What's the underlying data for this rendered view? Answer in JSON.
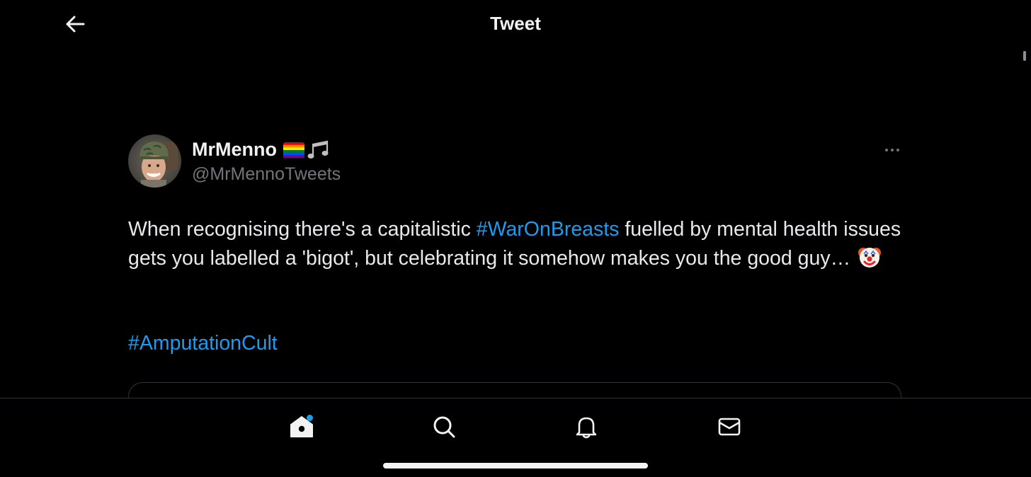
{
  "header": {
    "title": "Tweet",
    "back_icon": "arrow-left-icon"
  },
  "tweet": {
    "author": {
      "display_name": "MrMenno",
      "name_emojis": [
        "rainbow-flag-icon",
        "musical-notes-icon"
      ],
      "handle": "@MrMennoTweets"
    },
    "text": {
      "part1": "When recognising there's a capitalistic ",
      "hashtag1": "#WarOnBreasts",
      "part2": " fuelled by mental health issues gets you labelled a 'bigot', but celebrating it somehow makes you the good guy… ",
      "emoji": "clown-face-icon",
      "hashtag2": "#AmputationCult"
    }
  },
  "bottom_nav": {
    "items": [
      {
        "name": "home",
        "icon": "home-icon",
        "has_notification": true
      },
      {
        "name": "search",
        "icon": "search-icon",
        "has_notification": false
      },
      {
        "name": "notifications",
        "icon": "bell-icon",
        "has_notification": false
      },
      {
        "name": "messages",
        "icon": "mail-icon",
        "has_notification": false
      }
    ]
  },
  "colors": {
    "background": "#000000",
    "text": "#e7e9ea",
    "secondary_text": "#71767b",
    "accent": "#1d9bf0",
    "divider": "#2f3336"
  }
}
